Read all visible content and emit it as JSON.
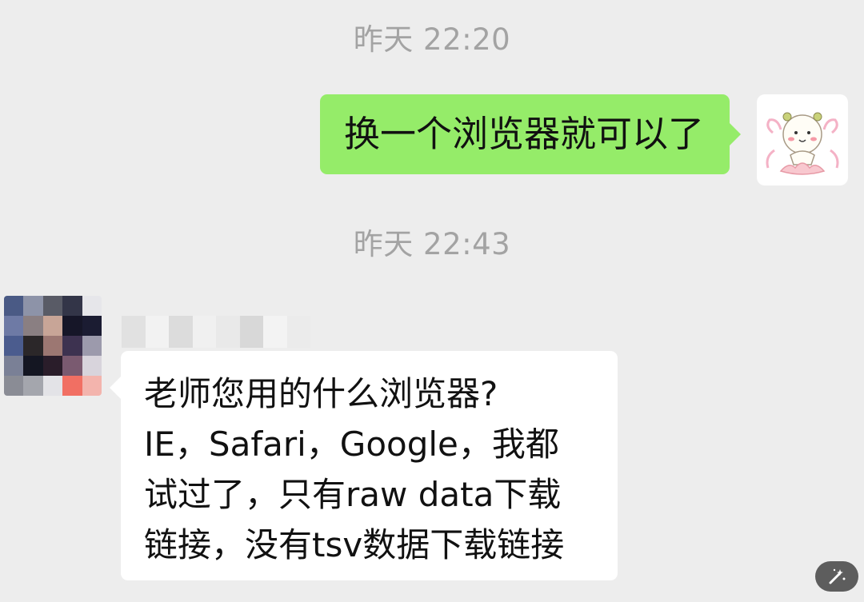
{
  "conversation": {
    "messages": [
      {
        "time": "昨天 22:20",
        "sender": "self",
        "text": "换一个浏览器就可以了"
      },
      {
        "time": "昨天 22:43",
        "sender": "other",
        "lines": [
          "老师您用的什么浏览器?",
          "IE，Safari，Google，我都",
          "试过了，只有raw data下载",
          "链接，没有tsv数据下载链接"
        ]
      }
    ]
  },
  "colors": {
    "background": "#ededed",
    "outgoing_bubble": "#95ec69",
    "incoming_bubble": "#ffffff",
    "timestamp_text": "#a3a3a3",
    "fab": "#5d5d5d"
  },
  "icons": {
    "self_avatar": "cartoon-character-sticker-icon",
    "other_avatar": "pixelated-avatar-icon",
    "edit": "magic-wand-icon"
  }
}
